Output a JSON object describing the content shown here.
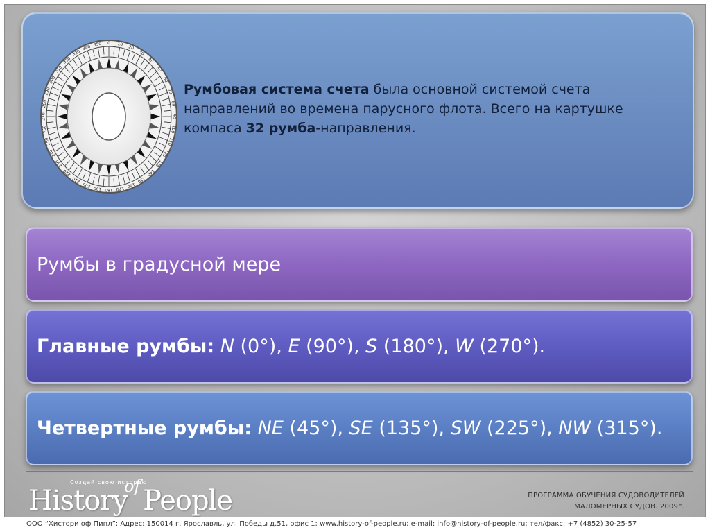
{
  "top": {
    "bold1": "Румбовая система счета",
    "text1": " была основной системой счета направлений во времена парусного флота. Всего на картушке компаса ",
    "bold2": "32 румба",
    "text2": "-направления."
  },
  "bar1": {
    "label": "Румбы в градусной мере"
  },
  "bar2": {
    "label": "Главные румбы:",
    "items": [
      {
        "code": "N",
        "deg": " (0°), "
      },
      {
        "code": "E",
        "deg": " (90°), "
      },
      {
        "code": "S",
        "deg": " (180°), "
      },
      {
        "code": "W",
        "deg": " (270°)."
      }
    ]
  },
  "bar3": {
    "label": "Четвертные румбы:",
    "items": [
      {
        "code": "NE",
        "deg": " (45°), "
      },
      {
        "code": "SE",
        "deg": " (135°), "
      },
      {
        "code": "SW",
        "deg": " (225°), "
      },
      {
        "code": "NW",
        "deg": " (315°)."
      }
    ]
  },
  "logo": {
    "history": "History",
    "of": "of",
    "people": "People",
    "tagline": "Создай свою историю"
  },
  "program": {
    "line1": "ПРОГРАММА ОБУЧЕНИЯ СУДОВОДИТЕЛЕЙ",
    "line2": "МАЛОМЕРНЫХ СУДОВ. 2009г."
  },
  "footer": "ООО “Хистори оф Пипл”; Адрес: 150014 г. Ярославль, ул. Победы д.51, офис 1; www.history-of-people.ru; e-mail: info@history-of-people.ru; тел/факс: +7 (4852) 30-25-57",
  "compass": {
    "degree_labels": [
      "0",
      "10",
      "20",
      "30",
      "40",
      "50",
      "60",
      "70",
      "80",
      "90",
      "100",
      "110",
      "120",
      "130",
      "140",
      "150",
      "160",
      "170",
      "180",
      "190",
      "200",
      "210",
      "220",
      "230",
      "240",
      "250",
      "260",
      "270",
      "280",
      "290",
      "300",
      "310",
      "320",
      "330",
      "340",
      "350"
    ]
  },
  "colors": {
    "top_panel": "#6d8fc3",
    "bar1": "#8d67c1",
    "bar2": "#5f5cc2",
    "bar3": "#5b7fc4"
  }
}
